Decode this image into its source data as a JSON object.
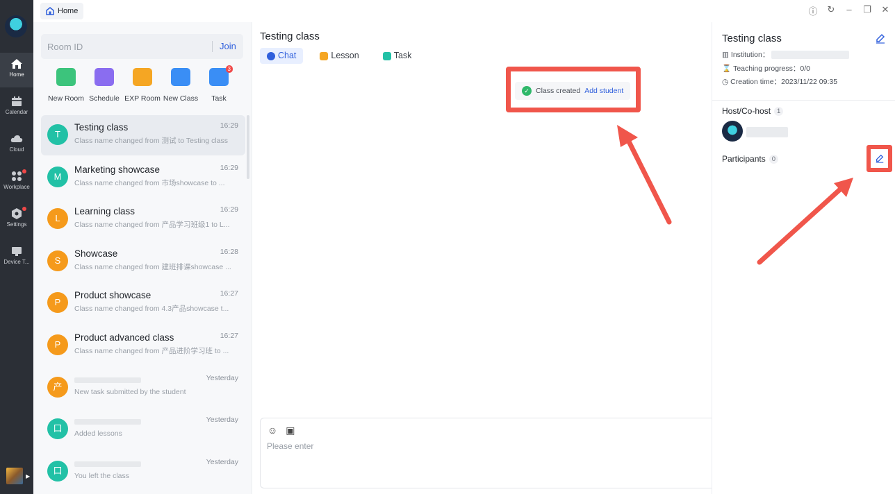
{
  "window": {
    "home_tab": "Home"
  },
  "nav": {
    "items": [
      {
        "label": "Home",
        "icon": "home-icon",
        "active": true
      },
      {
        "label": "Calendar",
        "icon": "calendar-icon"
      },
      {
        "label": "Cloud",
        "icon": "cloud-icon"
      },
      {
        "label": "Workplace",
        "icon": "apps-icon",
        "dot": true
      },
      {
        "label": "Settings",
        "icon": "gear-icon",
        "dot": true
      },
      {
        "label": "Device T...",
        "icon": "monitor-icon"
      }
    ]
  },
  "search": {
    "placeholder": "Room ID",
    "join": "Join"
  },
  "quick_actions": [
    {
      "label": "New Room",
      "color": "#3cc47c"
    },
    {
      "label": "Schedule",
      "color": "#8a6df0"
    },
    {
      "label": "EXP Room",
      "color": "#f5a623"
    },
    {
      "label": "New Class",
      "color": "#3a8ef5"
    },
    {
      "label": "Task",
      "color": "#3a8ef5",
      "badge": "3"
    }
  ],
  "conversations": [
    {
      "avatar": "T",
      "color": "#22c1a6",
      "name": "Testing class",
      "time": "16:29",
      "message": "Class name changed from 测试 to Testing class",
      "active": true
    },
    {
      "avatar": "M",
      "color": "#22c1a6",
      "name": "Marketing showcase",
      "time": "16:29",
      "message": "Class name changed from 市场showcase to ..."
    },
    {
      "avatar": "L",
      "color": "#f59a1b",
      "name": "Learning class",
      "time": "16:29",
      "message": "Class name changed from 产品学习班级1 to L..."
    },
    {
      "avatar": "S",
      "color": "#f59a1b",
      "name": "Showcase",
      "time": "16:28",
      "message": "Class name changed from 建班排课showcase ..."
    },
    {
      "avatar": "P",
      "color": "#f59a1b",
      "name": "Product showcase",
      "time": "16:27",
      "message": "Class name changed from 4.3产品showcase t..."
    },
    {
      "avatar": "P",
      "color": "#f59a1b",
      "name": "Product advanced class",
      "time": "16:27",
      "message": "Class name changed from 产品进阶学习班 to ..."
    },
    {
      "avatar": "产",
      "color": "#f59a1b",
      "name": "",
      "time": "Yesterday",
      "message": "New task submitted by the student"
    },
    {
      "avatar": "口",
      "color": "#22c1a6",
      "name": "",
      "time": "Yesterday",
      "message": "Added lessons"
    },
    {
      "avatar": "口",
      "color": "#22c1a6",
      "name": "",
      "time": "Yesterday",
      "message": "You left the class"
    }
  ],
  "chat": {
    "title": "Testing class",
    "tabs": [
      {
        "label": "Chat",
        "active": true,
        "color": "#2f5fdc"
      },
      {
        "label": "Lesson",
        "color": "#f5a623"
      },
      {
        "label": "Task",
        "color": "#22c1a6"
      }
    ],
    "notice": {
      "text": "Class created",
      "action": "Add student"
    },
    "composer_placeholder": "Please enter"
  },
  "info": {
    "title": "Testing class",
    "institution_label": "Institution：",
    "progress": "Teaching progress：0/0",
    "creation": "Creation time：2023/11/22 09:35",
    "host_label": "Host/Co-host",
    "host_count": "1",
    "participants_label": "Participants",
    "participants_count": "0"
  },
  "colors": {
    "accent": "#2f5fdc",
    "highlight": "#f0564b",
    "nav_bg": "#2b2f36"
  }
}
